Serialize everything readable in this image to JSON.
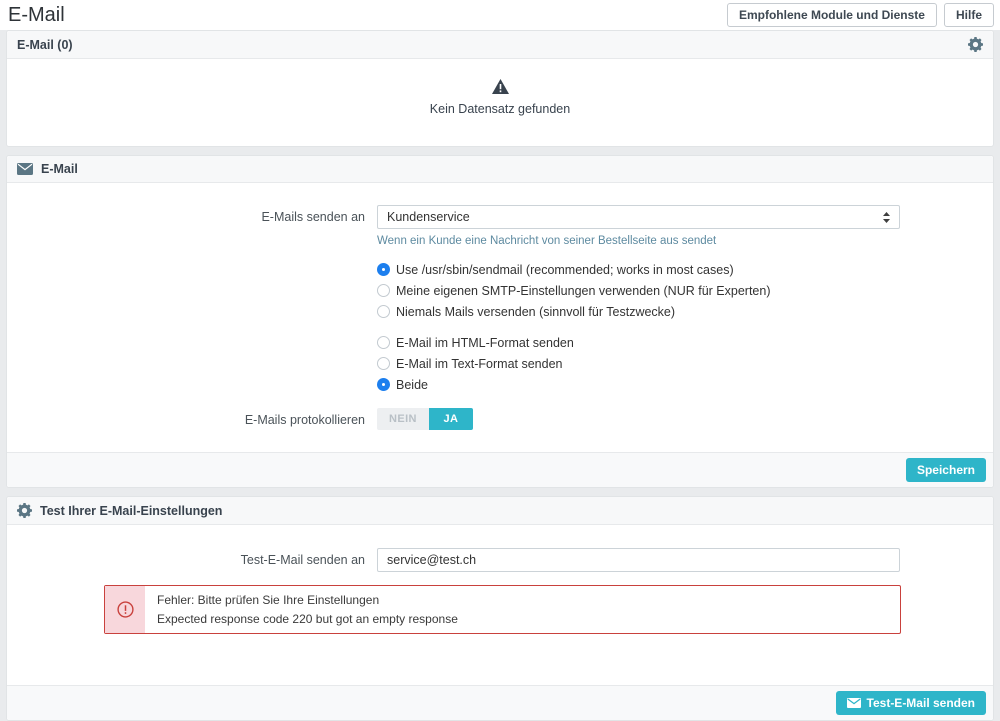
{
  "page": {
    "title": "E-Mail"
  },
  "topbar": {
    "modules_button": "Empfohlene Module und Dienste",
    "help_button": "Hilfe"
  },
  "email_list_panel": {
    "title": "E-Mail (0)",
    "empty_message": "Kein Datensatz gefunden"
  },
  "email_settings_panel": {
    "title": "E-Mail",
    "sender_row": {
      "label": "E-Mails senden an",
      "value": "Kundenservice",
      "helper": "Wenn ein Kunde eine Nachricht von seiner Bestellseite aus sendet"
    },
    "transport_options": [
      {
        "label": "Use /usr/sbin/sendmail (recommended; works in most cases)",
        "selected": true
      },
      {
        "label": "Meine eigenen SMTP-Einstellungen verwenden (NUR für Experten)",
        "selected": false
      },
      {
        "label": "Niemals Mails versenden (sinnvoll für Testzwecke)",
        "selected": false
      }
    ],
    "format_options": [
      {
        "label": "E-Mail im HTML-Format senden",
        "selected": false
      },
      {
        "label": "E-Mail im Text-Format senden",
        "selected": false
      },
      {
        "label": "Beide",
        "selected": true
      }
    ],
    "logging_row": {
      "label": "E-Mails protokollieren",
      "off_label": "NEIN",
      "on_label": "JA",
      "enabled": true
    },
    "save_button": "Speichern"
  },
  "test_panel": {
    "title": "Test Ihrer E-Mail-Einstellungen",
    "recipient_row": {
      "label": "Test-E-Mail senden an",
      "value": "service@test.ch"
    },
    "error": {
      "line1": "Fehler: Bitte prüfen Sie Ihre Einstellungen",
      "line2": "Expected response code 220 but got an empty response"
    },
    "send_button": "Test-E-Mail senden"
  },
  "colors": {
    "accent_teal": "#2eb5c9",
    "radio_blue": "#1d7fee",
    "error_red": "#c9413d",
    "header_icon_slate": "#5b7684"
  }
}
